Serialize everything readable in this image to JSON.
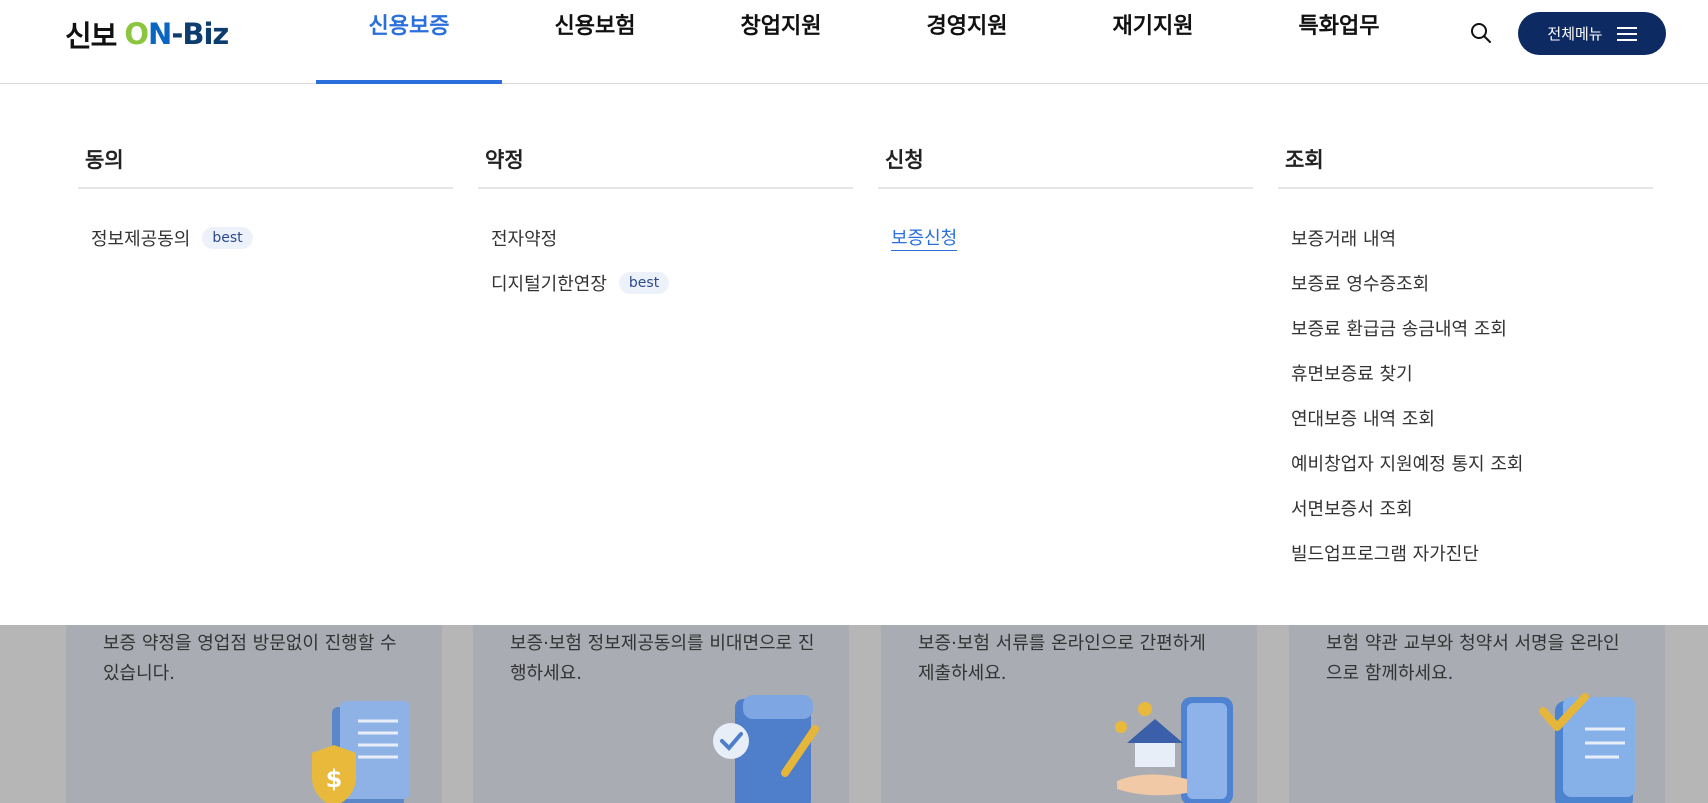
{
  "header": {
    "logo": {
      "ko": "신보",
      "o": "O",
      "n": "N",
      "biz": "-Biz"
    },
    "nav": [
      {
        "label": "신용보증"
      },
      {
        "label": "신용보험"
      },
      {
        "label": "창업지원"
      },
      {
        "label": "경영지원"
      },
      {
        "label": "재기지원"
      },
      {
        "label": "특화업무"
      }
    ],
    "search_icon": "search-icon",
    "all_menu_label": "전체메뉴",
    "active_color": "#2a6fdb",
    "button_color": "#0e2a63"
  },
  "mega_menu": {
    "columns": [
      {
        "title": "동의",
        "items": [
          {
            "label": "정보제공동의",
            "badge": "best"
          }
        ]
      },
      {
        "title": "약정",
        "items": [
          {
            "label": "전자약정"
          },
          {
            "label": "디지털기한연장",
            "badge": "best"
          }
        ]
      },
      {
        "title": "신청",
        "items": [
          {
            "label": "보증신청"
          }
        ]
      },
      {
        "title": "조회",
        "items": [
          {
            "label": "보증거래 내역"
          },
          {
            "label": "보증료 영수증조회"
          },
          {
            "label": "보증료 환급금 송금내역 조회"
          },
          {
            "label": "휴면보증료 찾기"
          },
          {
            "label": "연대보증 내역 조회"
          },
          {
            "label": "예비창업자 지원예정 통지 조회"
          },
          {
            "label": "서면보증서 조회"
          },
          {
            "label": "빌드업프로그램 자가진단"
          }
        ]
      }
    ]
  },
  "cards": [
    {
      "text": "보증 약정을 영업점 방문없이 진행할 수 있습니다.",
      "icon": "document-shield-dollar-icon"
    },
    {
      "text": "보증·보험 정보제공동의를 비대면으로 진행하세요.",
      "icon": "document-check-pen-icon"
    },
    {
      "text": "보증·보험 서류를 온라인으로 간편하게 제출하세요.",
      "icon": "hand-house-coin-icon"
    },
    {
      "text": "보험 약관 교부와 청약서 서명을 온라인으로 함께하세요.",
      "icon": "document-checkmark-icon"
    }
  ]
}
